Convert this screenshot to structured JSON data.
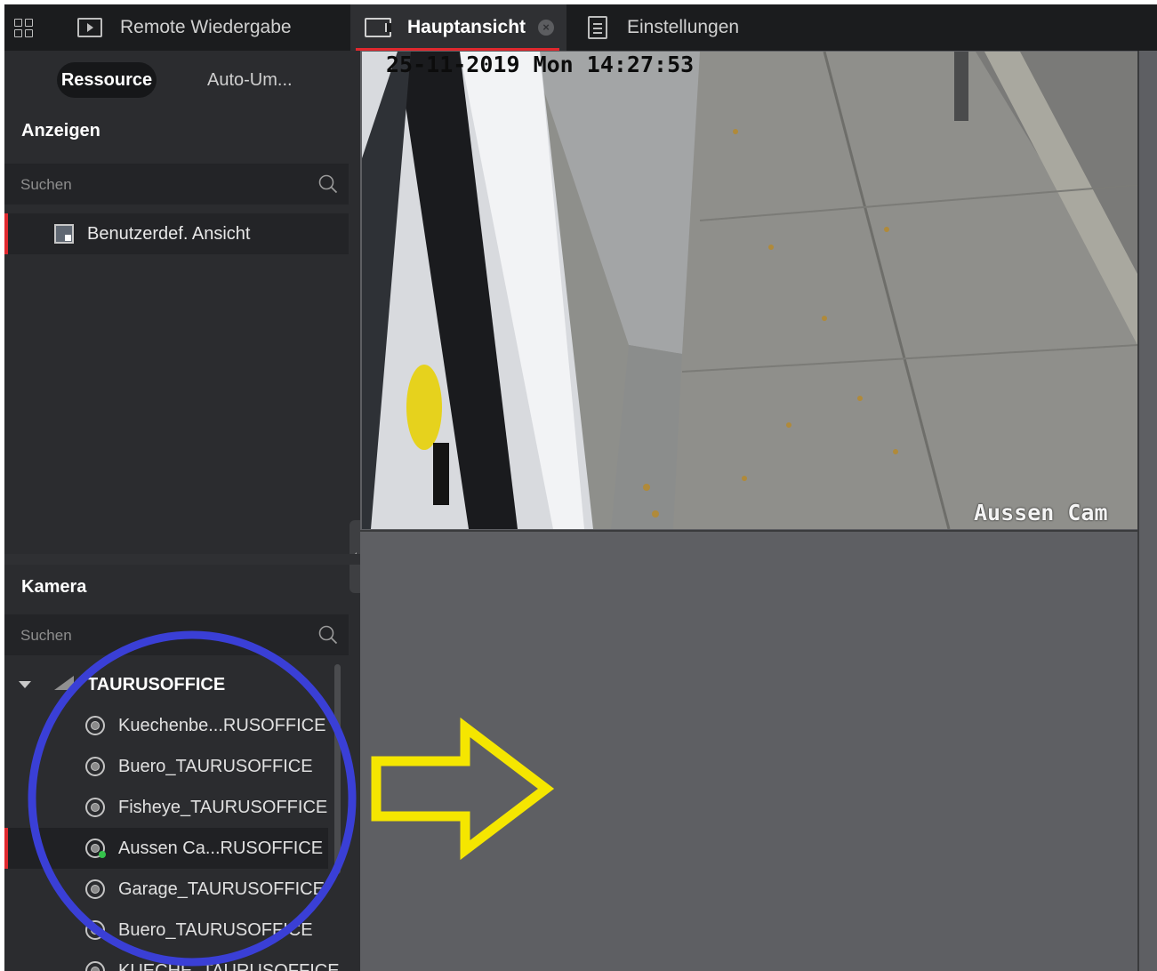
{
  "topbar": {
    "tabs": [
      {
        "label": "Remote Wiedergabe",
        "icon": "playback-icon",
        "active": false
      },
      {
        "label": "Hauptansicht",
        "icon": "camera-view-icon",
        "active": true,
        "closable": true
      },
      {
        "label": "Einstellungen",
        "icon": "settings-icon",
        "active": false
      }
    ]
  },
  "sidebar": {
    "tabs": [
      {
        "label": "Ressource",
        "active": true
      },
      {
        "label": "Auto-Um...",
        "active": false
      }
    ],
    "views_section": {
      "title": "Anzeigen",
      "search_placeholder": "Suchen",
      "items": [
        {
          "label": "Benutzerdef. Ansicht",
          "icon": "custom-view-icon",
          "selected": true
        }
      ]
    },
    "camera_section": {
      "title": "Kamera",
      "search_placeholder": "Suchen",
      "group": {
        "label": "TAURUSOFFICE",
        "expanded": true,
        "cameras": [
          {
            "label": "Kuechenbe...RUSOFFICE",
            "selected": false,
            "live": false
          },
          {
            "label": "Buero_TAURUSOFFICE",
            "selected": false,
            "live": false
          },
          {
            "label": "Fisheye_TAURUSOFFICE",
            "selected": false,
            "live": false
          },
          {
            "label": "Aussen Ca...RUSOFFICE",
            "selected": true,
            "live": true
          },
          {
            "label": "Garage_TAURUSOFFICE",
            "selected": false,
            "live": false
          },
          {
            "label": "Buero_TAURUSOFFICE",
            "selected": false,
            "live": false
          },
          {
            "label": "KUECHE_TAURUSOFFICE",
            "selected": false,
            "live": false
          }
        ]
      }
    }
  },
  "main": {
    "video_tile": {
      "timestamp": "25-11-2019 Mon 14:27:53",
      "camera_name": "Aussen Cam"
    }
  },
  "annotations": {
    "circle_color": "#3a3fd6",
    "arrow_color": "#f5e600"
  },
  "colors": {
    "accent": "#e0282e",
    "live_indicator": "#35c24b",
    "topbar_bg": "#1b1c1e",
    "sidebar_bg": "#2b2c2f",
    "main_bg": "#5e5f63"
  }
}
